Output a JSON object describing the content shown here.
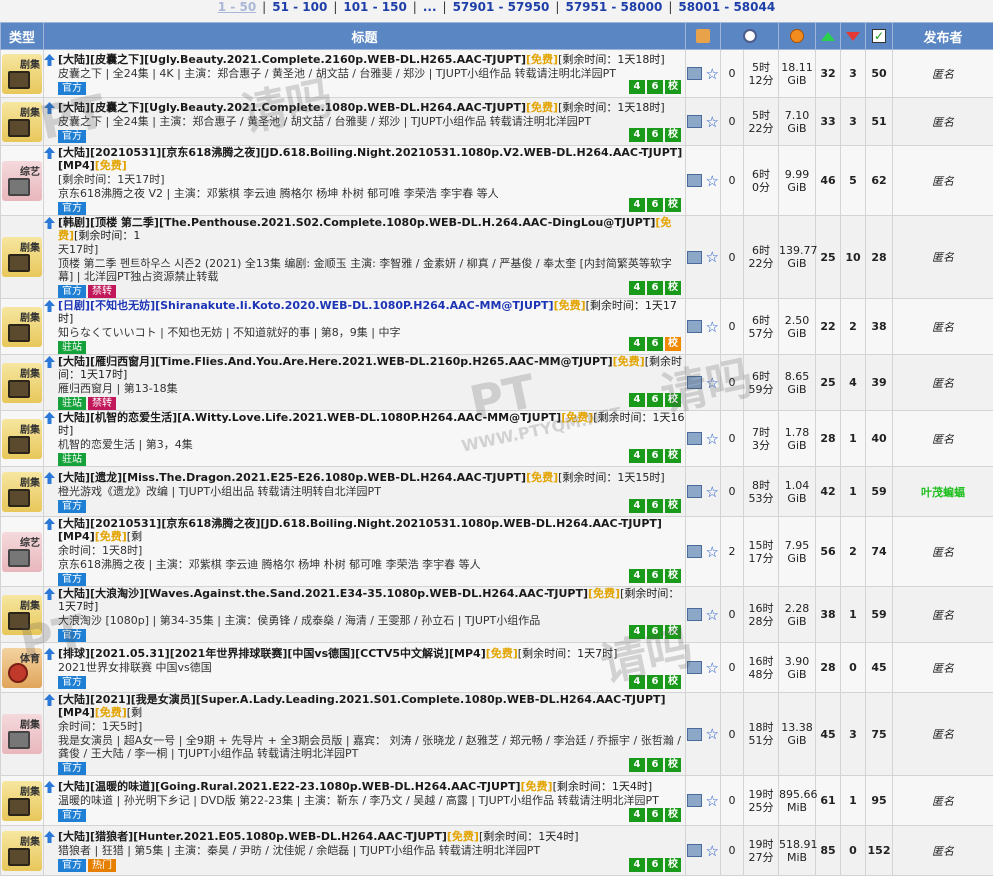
{
  "pager": [
    "1 - 50",
    "51 - 100",
    "101 - 150",
    "...",
    "57901 - 57950",
    "57951 - 58000",
    "58001 - 58044"
  ],
  "headers": {
    "type": "类型",
    "title": "标题",
    "publisher": "发布者"
  },
  "rows": [
    {
      "cat": "剧集",
      "cls": "tv",
      "title": "[大陆][皮囊之下][Ugly.Beauty.2021.Complete.2160p.WEB-DL.H265.AAC-TJUPT]",
      "free": "[免费]",
      "rem": "[剩余时间：1天18时]",
      "cont": "",
      "sub": "皮囊之下 | 全24集 | 4K | 主演：郑合惠子 / 黄圣池 / 胡文喆 / 台雅斐 / 郑沙 | TJUPT小组作品 转载请注明北洋园PT",
      "tags": [
        "官方"
      ],
      "badges": [
        "4",
        "6",
        "校"
      ],
      "comments": "0",
      "time1": "5时",
      "time2": "12分",
      "size1": "18.11",
      "size2": "GiB",
      "seed": "32",
      "leech": "3",
      "done": "50",
      "pub": "匿名"
    },
    {
      "cat": "剧集",
      "cls": "tv",
      "title": "[大陆][皮囊之下][Ugly.Beauty.2021.Complete.1080p.WEB-DL.H264.AAC-TJUPT]",
      "free": "[免费]",
      "rem": "[剩余时间：1天18时]",
      "cont": "",
      "sub": "皮囊之下 | 全24集 | 主演：郑合惠子 / 黄圣池 / 胡文喆 / 台雅斐 / 郑沙 | TJUPT小组作品 转载请注明北洋园PT",
      "tags": [
        "官方"
      ],
      "badges": [
        "4",
        "6",
        "校"
      ],
      "comments": "0",
      "time1": "5时",
      "time2": "22分",
      "size1": "7.10",
      "size2": "GiB",
      "seed": "33",
      "leech": "3",
      "done": "51",
      "pub": "匿名"
    },
    {
      "cat": "综艺",
      "cls": "var",
      "title": "[大陆][20210531][京东618沸腾之夜][JD.618.Boiling.Night.20210531.1080p.V2.WEB-DL.H264.AAC-TJUPT][MP4]",
      "free": "[免费]",
      "rem": "",
      "cont": "[剩余时间：1天17时]",
      "sub": "京东618沸腾之夜 V2 | 主演：邓紫棋 李云迪 腾格尔 杨坤 朴树 郁可唯 李荣浩 李宇春 等人",
      "tags": [
        "官方"
      ],
      "badges": [
        "4",
        "6",
        "校"
      ],
      "comments": "0",
      "time1": "6时",
      "time2": "0分",
      "size1": "9.99",
      "size2": "GiB",
      "seed": "46",
      "leech": "5",
      "done": "62",
      "pub": "匿名"
    },
    {
      "cat": "剧集",
      "cls": "tv",
      "title": "[韩剧][顶楼 第二季][The.Penthouse.2021.S02.Complete.1080p.WEB-DL.H.264.AAC-DingLou@TJUPT]",
      "free": "[免费]",
      "rem": "[剩余时间：1",
      "cont": "天17时]",
      "sub": "顶楼 第二季 펜트하우스 시즌2 (2021) 全13集 编剧: 金顺玉 主演: 李智雅 / 金素妍 / 柳真 / 严基俊 / 奉太奎 [内封简繁英等软字幕] | 北洋园PT独占资源禁止转载",
      "tags": [
        "官方",
        "禁转"
      ],
      "badges": [
        "4",
        "6",
        "校"
      ],
      "comments": "0",
      "time1": "6时",
      "time2": "22分",
      "size1": "139.77",
      "size2": "GiB",
      "seed": "25",
      "leech": "10",
      "done": "28",
      "pub": "匿名"
    },
    {
      "cat": "剧集",
      "cls": "tv",
      "blue": true,
      "title": "[日剧][不知也无妨][Shiranakute.Ii.Koto.2020.WEB-DL.1080P.H264.AAC-MM@TJUPT]",
      "free": "[免费]",
      "rem": "[剩余时间：1天17时]",
      "cont": "",
      "sub": "知らなくていいコト | 不知也无妨 | 不知道就好的事 | 第8，9集 | 中字",
      "tags": [
        "驻站"
      ],
      "badges": [
        "4",
        "6",
        "校"
      ],
      "orange": true,
      "comments": "0",
      "time1": "6时",
      "time2": "57分",
      "size1": "2.50",
      "size2": "GiB",
      "seed": "22",
      "leech": "2",
      "done": "38",
      "pub": "匿名"
    },
    {
      "cat": "剧集",
      "cls": "tv",
      "title": "[大陆][雁归西窗月][Time.Flies.And.You.Are.Here.2021.WEB-DL.2160p.H265.AAC-MM@TJUPT]",
      "free": "[免费]",
      "rem": "[剩余时间：1天17时]",
      "cont": "",
      "sub": "雁归西窗月 | 第13-18集",
      "tags": [
        "驻站",
        "禁转"
      ],
      "badges": [
        "4",
        "6",
        "校"
      ],
      "comments": "0",
      "time1": "6时",
      "time2": "59分",
      "size1": "8.65",
      "size2": "GiB",
      "seed": "25",
      "leech": "4",
      "done": "39",
      "pub": "匿名"
    },
    {
      "cat": "剧集",
      "cls": "tv",
      "title": "[大陆][机智的恋爱生活][A.Witty.Love.Life.2021.WEB-DL.1080P.H264.AAC-MM@TJUPT]",
      "free": "[免费]",
      "rem": "[剩余时间：1天16时]",
      "cont": "",
      "sub": "机智的恋爱生活 | 第3，4集",
      "tags": [
        "驻站"
      ],
      "badges": [
        "4",
        "6",
        "校"
      ],
      "comments": "0",
      "time1": "7时",
      "time2": "3分",
      "size1": "1.78",
      "size2": "GiB",
      "seed": "28",
      "leech": "1",
      "done": "40",
      "pub": "匿名"
    },
    {
      "cat": "剧集",
      "cls": "tv",
      "title": "[大陆][遗龙][Miss.The.Dragon.2021.E25-E26.1080p.WEB-DL.H264.AAC-TJUPT]",
      "free": "[免费]",
      "rem": "[剩余时间：1天15时]",
      "cont": "",
      "sub": "橙光游戏《遗龙》改编 | TJUPT小组出品 转载请注明转自北洋园PT",
      "tags": [
        "官方"
      ],
      "badges": [
        "4",
        "6",
        "校"
      ],
      "comments": "0",
      "time1": "8时",
      "time2": "53分",
      "size1": "1.04",
      "size2": "GiB",
      "seed": "42",
      "leech": "1",
      "done": "59",
      "pub": "叶茂蝙蝠",
      "pubGreen": true
    },
    {
      "cat": "综艺",
      "cls": "var",
      "title": "[大陆][20210531][京东618沸腾之夜][JD.618.Boiling.Night.20210531.1080p.WEB-DL.H264.AAC-TJUPT][MP4]",
      "free": "[免费]",
      "rem": "[剩",
      "cont": "余时间：1天8时]",
      "sub": "京东618沸腾之夜 | 主演：邓紫棋 李云迪 腾格尔 杨坤 朴树 郁可唯 李荣浩 李宇春 等人",
      "tags": [
        "官方"
      ],
      "badges": [
        "4",
        "6",
        "校"
      ],
      "comments": "2",
      "time1": "15时",
      "time2": "17分",
      "size1": "7.95",
      "size2": "GiB",
      "seed": "56",
      "leech": "2",
      "done": "74",
      "pub": "匿名"
    },
    {
      "cat": "剧集",
      "cls": "tv",
      "title": "[大陆][大浪淘沙][Waves.Against.the.Sand.2021.E34-35.1080p.WEB-DL.H264.AAC-TJUPT]",
      "free": "[免费]",
      "rem": "[剩余时间：1天7时]",
      "cont": "",
      "sub": "大浪淘沙 [1080p] | 第34-35集 | 主演：侯勇锋 / 成泰燊 / 海清 / 王雯那 / 孙立石 | TJUPT小组作品",
      "tags": [
        "官方"
      ],
      "badges": [
        "4",
        "6",
        "校"
      ],
      "comments": "0",
      "time1": "16时",
      "time2": "28分",
      "size1": "2.28",
      "size2": "GiB",
      "seed": "38",
      "leech": "1",
      "done": "59",
      "pub": "匿名"
    },
    {
      "cat": "体育",
      "cls": "sp",
      "title": "[排球][2021.05.31][2021年世界排球联赛][中国vs德国][CCTV5中文解说][MP4]",
      "free": "[免费]",
      "rem": "[剩余时间：1天7时]",
      "cont": "",
      "sub": "2021世界女排联赛 中国vs德国",
      "tags": [
        "官方"
      ],
      "badges": [
        "4",
        "6",
        "校"
      ],
      "comments": "0",
      "time1": "16时",
      "time2": "48分",
      "size1": "3.90",
      "size2": "GiB",
      "seed": "28",
      "leech": "0",
      "done": "45",
      "pub": "匿名"
    },
    {
      "cat": "剧集",
      "cls": "var",
      "title": "[大陆][2021][我是女演员][Super.A.Lady.Leading.2021.S01.Complete.1080p.WEB-DL.H264.AAC-TJUPT][MP4]",
      "free": "[免费]",
      "rem": "[剩",
      "cont": "余时间：1天5时]",
      "sub": "我是女演员 | 超A女一号 | 全9期 + 先导片 + 全3期会员版 | 嘉宾： 刘涛 / 张晓龙 / 赵雅芝 / 郑元畅 / 李治廷 / 乔振宇 / 张哲瀚 / 龚俊 / 王大陆 / 李一桐 | TJUPT小组作品 转载请注明北洋园PT",
      "tags": [
        "官方"
      ],
      "badges": [
        "4",
        "6",
        "校"
      ],
      "comments": "0",
      "time1": "18时",
      "time2": "51分",
      "size1": "13.38",
      "size2": "GiB",
      "seed": "45",
      "leech": "3",
      "done": "75",
      "pub": "匿名"
    },
    {
      "cat": "剧集",
      "cls": "tv",
      "title": "[大陆][温暖的味道][Going.Rural.2021.E22-23.1080p.WEB-DL.H264.AAC-TJUPT]",
      "free": "[免费]",
      "rem": "[剩余时间：1天4时]",
      "cont": "",
      "sub": "温暖的味道 | 孙光明下乡记 | DVD版 第22-23集 | 主演：靳东 / 李乃文 / 吴越 / 高露 | TJUPT小组作品 转载请注明北洋园PT",
      "tags": [
        "官方"
      ],
      "badges": [
        "4",
        "6",
        "校"
      ],
      "comments": "0",
      "time1": "19时",
      "time2": "25分",
      "size1": "895.66",
      "size2": "MiB",
      "seed": "61",
      "leech": "1",
      "done": "95",
      "pub": "匿名"
    },
    {
      "cat": "剧集",
      "cls": "tv",
      "title": "[大陆][猎狼者][Hunter.2021.E05.1080p.WEB-DL.H264.AAC-TJUPT]",
      "free": "[免费]",
      "rem": "[剩余时间：1天4时]",
      "cont": "",
      "sub": "猎狼者 | 狂猎 | 第5集 | 主演：秦昊 / 尹昉 / 沈佳妮 / 余皑磊 | TJUPT小组作品 转载请注明北洋园PT",
      "tags": [
        "官方",
        "热门"
      ],
      "badges": [
        "4",
        "6",
        "校"
      ],
      "comments": "0",
      "time1": "19时",
      "time2": "27分",
      "size1": "518.91",
      "size2": "MiB",
      "seed": "85",
      "leech": "0",
      "done": "152",
      "pub": "匿名"
    }
  ],
  "watermarks": [
    "PT",
    "请吗",
    "PT",
    "请吗",
    "PT",
    "请吗",
    "WWW.PTYQM.NET"
  ]
}
